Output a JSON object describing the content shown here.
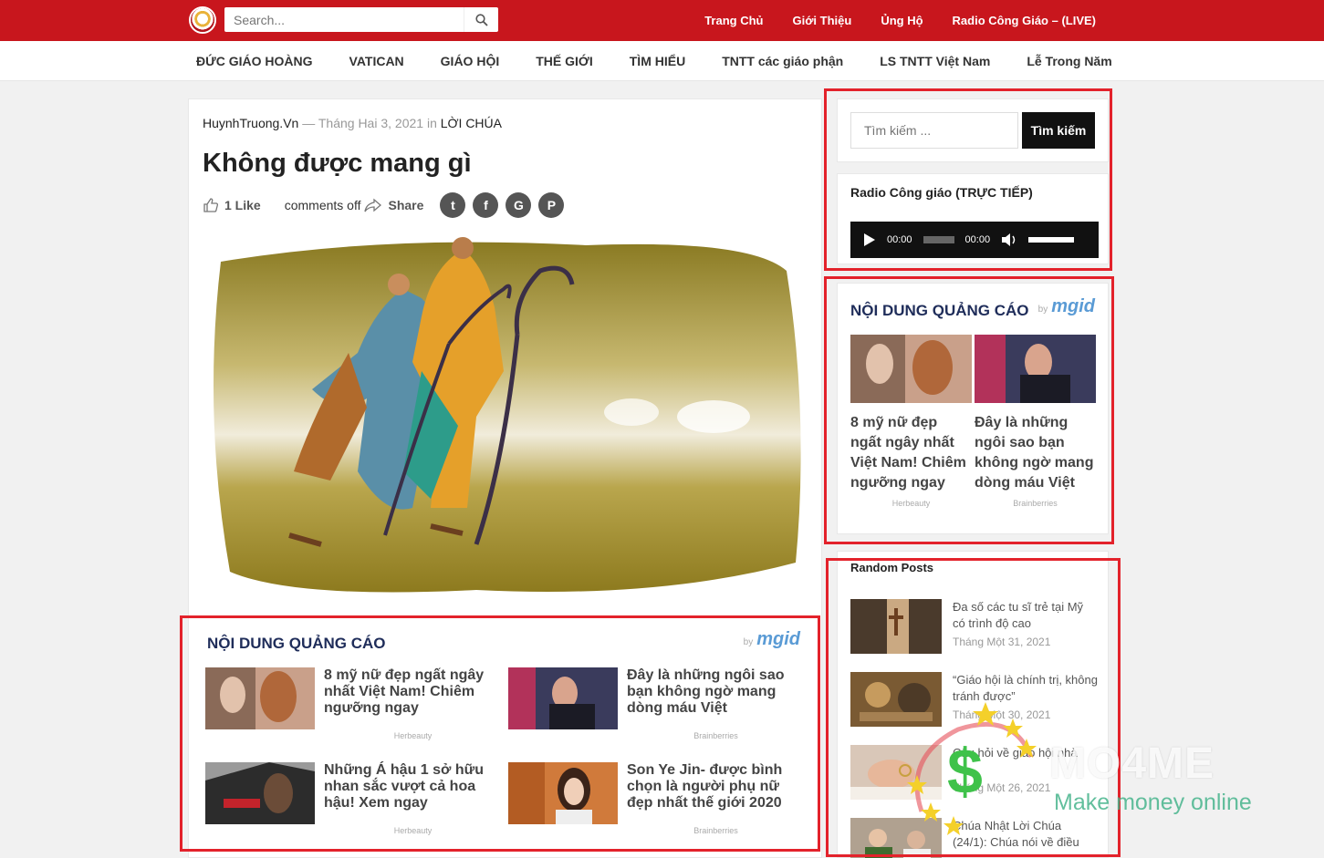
{
  "header": {
    "search_placeholder": "Search...",
    "nav": [
      "Trang Chủ",
      "Giới Thiệu",
      "Ủng Hộ",
      "Radio Công Giáo – (LIVE)"
    ]
  },
  "menu": [
    "ĐỨC GIÁO HOÀNG",
    "VATICAN",
    "GIÁO HỘI",
    "THẾ GIỚI",
    "TÌM HIỂU",
    "TNTT các giáo phận",
    "LS TNTT Việt Nam",
    "Lễ Trong Năm"
  ],
  "article": {
    "author": "HuynhTruong.Vn",
    "date": "Tháng Hai 3, 2021",
    "in": "in",
    "category": "LỜI CHÚA",
    "title": "Không được mang gì",
    "likes": "1 Like",
    "comments": "comments off",
    "share": "Share",
    "social": [
      "t",
      "f",
      "G",
      "P"
    ]
  },
  "main_ads": {
    "heading": "NỘI DUNG QUẢNG CÁO",
    "by": "by",
    "brand": "mgid",
    "items": [
      {
        "title": "8 mỹ nữ đẹp ngất ngây nhất Việt Nam! Chiêm ngưỡng ngay",
        "source": "Herbeauty"
      },
      {
        "title": "Đây là những ngôi sao bạn không ngờ mang dòng máu Việt",
        "source": "Brainberries"
      },
      {
        "title": "Những Á hậu 1 sở hữu nhan sắc vượt cả hoa hậu! Xem ngay",
        "source": "Herbeauty"
      },
      {
        "title": "Son Ye Jin- được bình chọn là người phụ nữ đẹp nhất thế giới 2020",
        "source": "Brainberries"
      }
    ]
  },
  "sidebar": {
    "search_placeholder": "Tìm kiếm ...",
    "search_button": "Tìm kiếm",
    "radio_title": "Radio Công giáo (TRỰC TIẾP)",
    "player_time_start": "00:00",
    "player_time_end": "00:00",
    "ads": {
      "heading": "NỘI DUNG QUẢNG CÁO",
      "by": "by",
      "brand": "mgid",
      "items": [
        {
          "title": "8 mỹ nữ đẹp ngất ngây nhất Việt Nam! Chiêm ngưỡng ngay",
          "source": "Herbeauty"
        },
        {
          "title": "Đây là những ngôi sao bạn không ngờ mang dòng máu Việt",
          "source": "Brainberries"
        }
      ]
    },
    "random_posts": {
      "heading": "Random Posts",
      "items": [
        {
          "title": "Đa số các tu sĩ trẻ tại Mỹ có trình độ cao",
          "date": "Tháng Một 31, 2021"
        },
        {
          "title": "“Giáo hội là chính trị, không tránh được”",
          "date": "Tháng Một 30, 2021"
        },
        {
          "title": "Câu hỏi về giáo hội nhà",
          "date": "Tháng Một 26, 2021"
        },
        {
          "title": "Chúa Nhật Lời Chúa (24/1): Chúa nói về điều",
          "date": ""
        }
      ]
    }
  },
  "watermark": {
    "brand": "MO4ME",
    "tagline": "Make money online"
  }
}
